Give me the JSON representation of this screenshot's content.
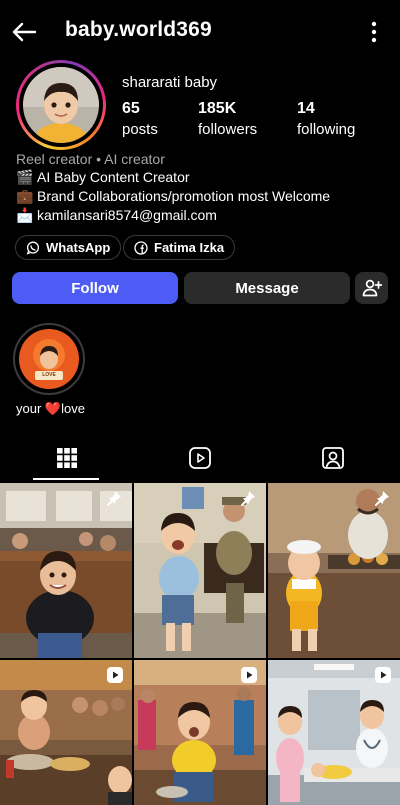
{
  "header": {
    "username": "baby.world369"
  },
  "profile": {
    "display_name": "shararati baby",
    "stats": [
      {
        "value": "65",
        "label": "posts"
      },
      {
        "value": "185K",
        "label": "followers"
      },
      {
        "value": "14",
        "label": "following"
      }
    ],
    "category": "Reel creator • AI creator",
    "bio": [
      {
        "emoji": "🎬",
        "text": "AI Baby Content Creator"
      },
      {
        "emoji": "💼",
        "text": "Brand Collaborations/promotion most Welcome"
      },
      {
        "emoji": "📩",
        "text": "kamilansari8574@gmail.com"
      }
    ],
    "links": [
      {
        "icon": "whatsapp-icon",
        "label": "WhatsApp"
      },
      {
        "icon": "facebook-icon",
        "label": "Fatima Izka"
      }
    ]
  },
  "actions": {
    "follow_label": "Follow",
    "message_label": "Message"
  },
  "highlight": {
    "label_prefix": "your",
    "label_suffix": "love",
    "cover_text": "LOVE"
  },
  "tabs": [
    {
      "icon": "grid-icon",
      "active": true
    },
    {
      "icon": "reels-icon",
      "active": false
    },
    {
      "icon": "tagged-icon",
      "active": false
    }
  ],
  "posts": [
    {
      "badge": "pin-icon",
      "scene": "Toddler in black jacket on a train seat"
    },
    {
      "badge": "pin-icon",
      "scene": "Toddler crying in a police station"
    },
    {
      "badge": "pin-icon",
      "scene": "Toddler in yellow overalls at a street food stall"
    },
    {
      "badge": "reel-icon",
      "scene": "Toddler cooking at a street market"
    },
    {
      "badge": "reel-icon",
      "scene": "Toddler in yellow shirt at a crowded market"
    },
    {
      "badge": "reel-icon",
      "scene": "Toddler doctor examining a baby in hospital"
    }
  ],
  "colors": {
    "accent": "#4d5cf5",
    "secondary_button": "#2b2b2b",
    "muted_text": "#a8a8a8",
    "heart": "#e8473d"
  }
}
